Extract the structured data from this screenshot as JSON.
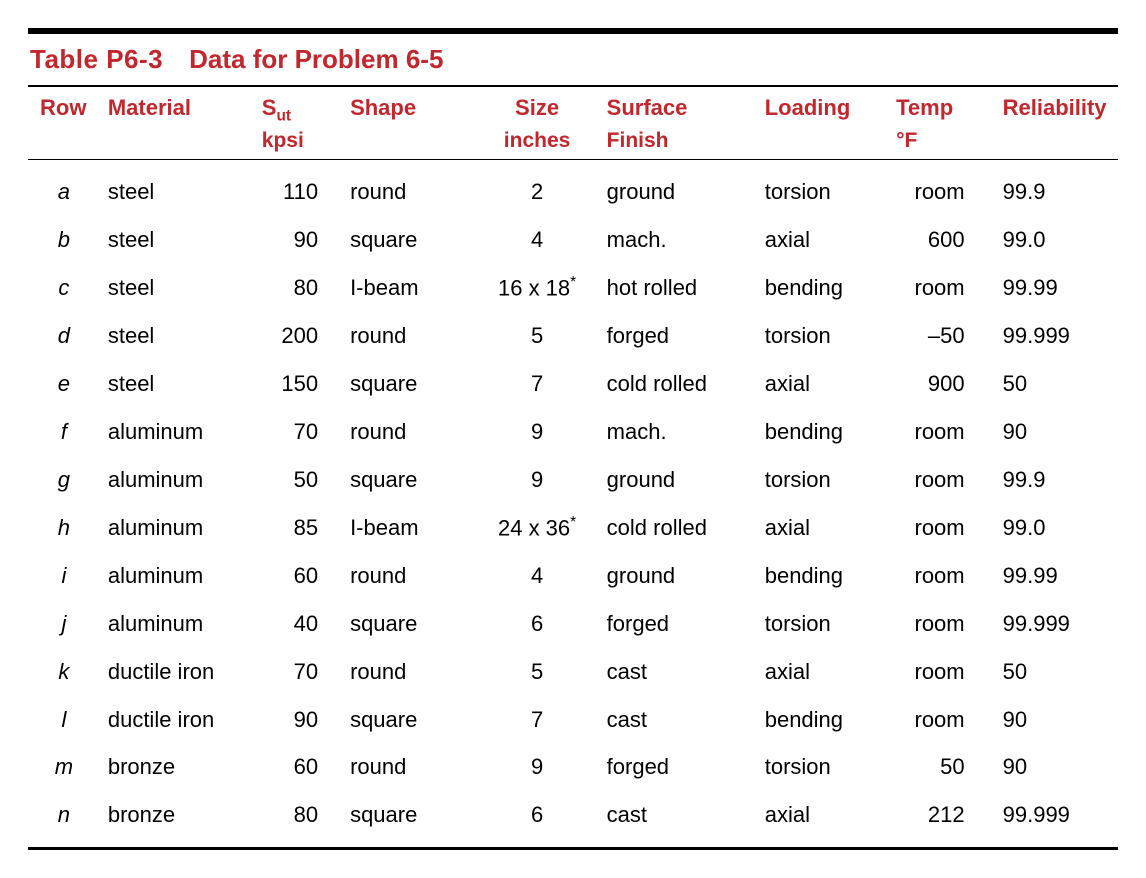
{
  "table": {
    "label": "Table  P6-3",
    "title": "Data for Problem 6-5",
    "headers": {
      "row": "Row",
      "material": "Material",
      "sut_html": "S<sub>ut</sub>",
      "sut_unit": "kpsi",
      "shape": "Shape",
      "size": "Size",
      "size_unit": "inches",
      "surface": "Surface",
      "surface2": "Finish",
      "loading": "Loading",
      "temp": "Temp",
      "temp_unit_html": "°F",
      "reliability": "Reliability"
    },
    "rows": [
      {
        "row": "a",
        "material": "steel",
        "sut": "110",
        "shape": "round",
        "size": "2",
        "size_star": false,
        "surface": "ground",
        "loading": "torsion",
        "temp": "room",
        "reliability": "99.9"
      },
      {
        "row": "b",
        "material": "steel",
        "sut": "90",
        "shape": "square",
        "size": "4",
        "size_star": false,
        "surface": "mach.",
        "loading": "axial",
        "temp": "600",
        "reliability": "99.0"
      },
      {
        "row": "c",
        "material": "steel",
        "sut": "80",
        "shape": "I-beam",
        "size": "16 x 18",
        "size_star": true,
        "surface": "hot rolled",
        "loading": "bending",
        "temp": "room",
        "reliability": "99.99"
      },
      {
        "row": "d",
        "material": "steel",
        "sut": "200",
        "shape": "round",
        "size": "5",
        "size_star": false,
        "surface": "forged",
        "loading": "torsion",
        "temp": "–50",
        "reliability": "99.999"
      },
      {
        "row": "e",
        "material": "steel",
        "sut": "150",
        "shape": "square",
        "size": "7",
        "size_star": false,
        "surface": "cold rolled",
        "loading": "axial",
        "temp": "900",
        "reliability": "50"
      },
      {
        "row": "f",
        "material": "aluminum",
        "sut": "70",
        "shape": "round",
        "size": "9",
        "size_star": false,
        "surface": "mach.",
        "loading": "bending",
        "temp": "room",
        "reliability": "90"
      },
      {
        "row": "g",
        "material": "aluminum",
        "sut": "50",
        "shape": "square",
        "size": "9",
        "size_star": false,
        "surface": "ground",
        "loading": "torsion",
        "temp": "room",
        "reliability": "99.9"
      },
      {
        "row": "h",
        "material": "aluminum",
        "sut": "85",
        "shape": "I-beam",
        "size": "24 x 36",
        "size_star": true,
        "surface": "cold rolled",
        "loading": "axial",
        "temp": "room",
        "reliability": "99.0"
      },
      {
        "row": "i",
        "material": "aluminum",
        "sut": "60",
        "shape": "round",
        "size": "4",
        "size_star": false,
        "surface": "ground",
        "loading": "bending",
        "temp": "room",
        "reliability": "99.99"
      },
      {
        "row": "j",
        "material": "aluminum",
        "sut": "40",
        "shape": "square",
        "size": "6",
        "size_star": false,
        "surface": "forged",
        "loading": "torsion",
        "temp": "room",
        "reliability": "99.999"
      },
      {
        "row": "k",
        "material": "ductile iron",
        "sut": "70",
        "shape": "round",
        "size": "5",
        "size_star": false,
        "surface": "cast",
        "loading": "axial",
        "temp": "room",
        "reliability": "50"
      },
      {
        "row": "l",
        "material": "ductile iron",
        "sut": "90",
        "shape": "square",
        "size": "7",
        "size_star": false,
        "surface": "cast",
        "loading": "bending",
        "temp": "room",
        "reliability": "90"
      },
      {
        "row": "m",
        "material": "bronze",
        "sut": "60",
        "shape": "round",
        "size": "9",
        "size_star": false,
        "surface": "forged",
        "loading": "torsion",
        "temp": "50",
        "reliability": "90"
      },
      {
        "row": "n",
        "material": "bronze",
        "sut": "80",
        "shape": "square",
        "size": "6",
        "size_star": false,
        "surface": "cast",
        "loading": "axial",
        "temp": "212",
        "reliability": "99.999"
      }
    ]
  }
}
